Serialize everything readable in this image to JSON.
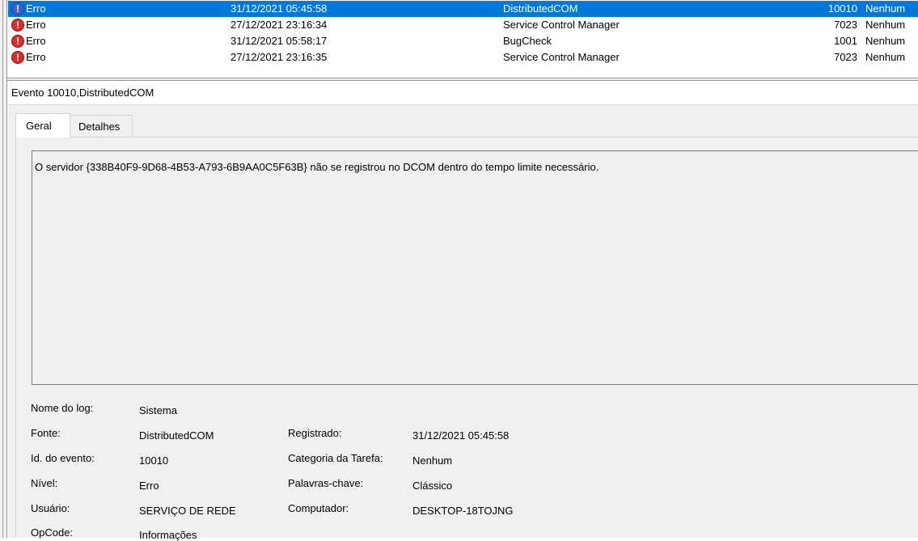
{
  "event_list": {
    "rows": [
      {
        "level": "Erro",
        "date": "31/12/2021 05:45:58",
        "source": "DistributedCOM",
        "event_id": "10010",
        "task_category": "Nenhum",
        "selected": true
      },
      {
        "level": "Erro",
        "date": "27/12/2021 23:16:34",
        "source": "Service Control Manager",
        "event_id": "7023",
        "task_category": "Nenhum",
        "selected": false
      },
      {
        "level": "Erro",
        "date": "31/12/2021 05:58:17",
        "source": "BugCheck",
        "event_id": "1001",
        "task_category": "Nenhum",
        "selected": false
      },
      {
        "level": "Erro",
        "date": "27/12/2021 23:16:35",
        "source": "Service Control Manager",
        "event_id": "7023",
        "task_category": "Nenhum",
        "selected": false
      }
    ],
    "error_icon_glyph": "!",
    "icon": "error-icon",
    "colors": {
      "selected_bg": "#0078d7",
      "error_icon": "#d32f2f"
    }
  },
  "details": {
    "title": "Evento 10010,DistributedCOM",
    "tabs": [
      {
        "label": "Geral",
        "active": true
      },
      {
        "label": "Detalhes",
        "active": false
      }
    ],
    "message": "O servidor {338B40F9-9D68-4B53-A793-6B9AA0C5F63B} não se registrou no DCOM dentro do tempo limite necessário.",
    "fields": {
      "log_name": {
        "label": "Nome do log:",
        "value": "Sistema"
      },
      "source": {
        "label": "Fonte:",
        "value": "DistributedCOM"
      },
      "logged": {
        "label": "Registrado:",
        "value": "31/12/2021 05:45:58"
      },
      "event_id": {
        "label": "Id. do evento:",
        "value": "10010"
      },
      "task_category": {
        "label": "Categoria da Tarefa:",
        "value": "Nenhum"
      },
      "level": {
        "label": "Nível:",
        "value": "Erro"
      },
      "keywords": {
        "label": "Palavras-chave:",
        "value": "Clássico"
      },
      "user": {
        "label": "Usuário:",
        "value": "SERVIÇO DE REDE"
      },
      "computer": {
        "label": "Computador:",
        "value": "DESKTOP-18TOJNG"
      },
      "opcode": {
        "label": "OpCode:",
        "value": "Informações"
      }
    }
  }
}
